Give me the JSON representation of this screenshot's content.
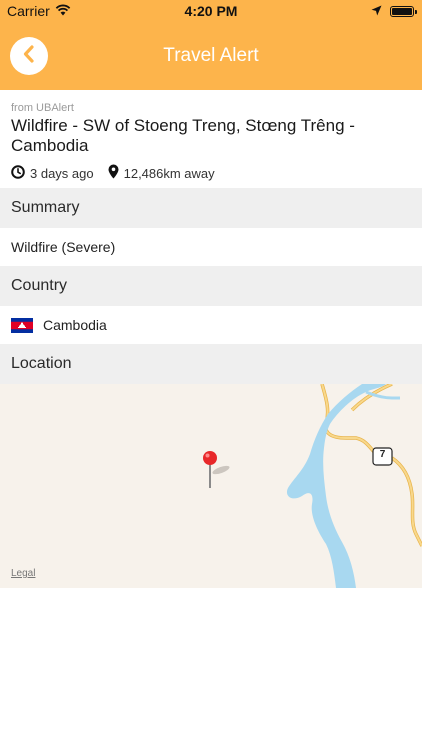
{
  "status_bar": {
    "carrier": "Carrier",
    "time": "4:20 PM"
  },
  "nav": {
    "title": "Travel Alert",
    "back_icon": "chevron-left-icon"
  },
  "alert": {
    "source": "from UBAlert",
    "title": "Wildfire - SW of Stoeng Treng, Stœng Trêng - Cambodia",
    "time_ago": "3 days ago",
    "distance": "12,486km away"
  },
  "sections": {
    "summary": {
      "header": "Summary",
      "value": "Wildfire (Severe)"
    },
    "country": {
      "header": "Country",
      "value": "Cambodia"
    },
    "location": {
      "header": "Location"
    }
  },
  "map": {
    "route_shield": "7",
    "legal": "Legal"
  },
  "colors": {
    "accent": "#fdb44b",
    "section_bg": "#efefef",
    "map_land": "#f7f2eb",
    "map_water": "#a8d8f0",
    "map_road": "#f5c96a",
    "pin": "#e8282a"
  }
}
